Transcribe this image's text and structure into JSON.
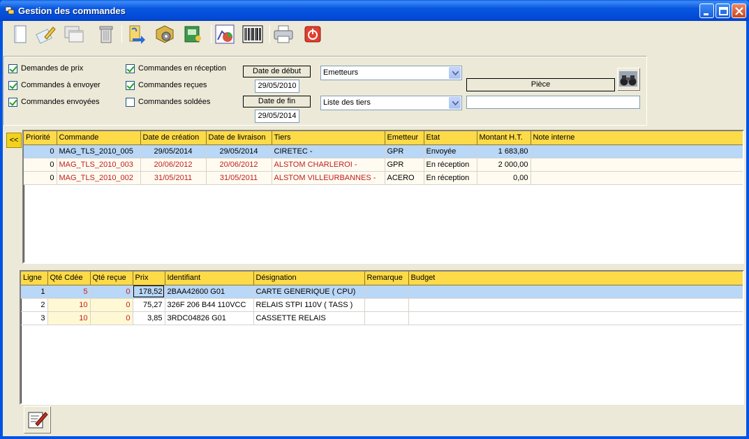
{
  "window": {
    "title": "Gestion des commandes"
  },
  "toolbar": {
    "tools": [
      {
        "name": "new-document"
      },
      {
        "name": "edit"
      },
      {
        "name": "duplicate"
      },
      {
        "name": "delete"
      },
      {
        "name": "transfer"
      },
      {
        "name": "settings"
      },
      {
        "name": "catalog"
      },
      {
        "name": "chart"
      },
      {
        "name": "barcode"
      },
      {
        "name": "print"
      },
      {
        "name": "quit"
      }
    ]
  },
  "filters": {
    "checkboxes": [
      {
        "label": "Demandes de prix",
        "checked": true
      },
      {
        "label": "Commandes à envoyer",
        "checked": true
      },
      {
        "label": "Commandes envoyées",
        "checked": true
      },
      {
        "label": "Commandes en réception",
        "checked": true
      },
      {
        "label": "Commandes reçues",
        "checked": true
      },
      {
        "label": "Commandes soldées",
        "checked": false
      }
    ],
    "date_start_label": "Date de début",
    "date_start_value": "29/05/2010",
    "date_end_label": "Date de fin",
    "date_end_value": "29/05/2014",
    "emetteurs_value": "Emetteurs",
    "tiers_value": "Liste des tiers",
    "piece_label": "Pièce",
    "piece_value": ""
  },
  "orders": {
    "columns": [
      "Priorité",
      "Commande",
      "Date de création",
      "Date de livraison",
      "Tiers",
      "Emetteur",
      "Etat",
      "Montant H.T.",
      "Note interne"
    ],
    "rows": [
      {
        "priorite": "0",
        "commande": "MAG_TLS_2010_005",
        "creation": "29/05/2014",
        "livraison": "29/05/2014",
        "tiers": "CIRETEC -",
        "emetteur": "GPR",
        "etat": "Envoyée",
        "montant": "1 683,80",
        "note": ""
      },
      {
        "priorite": "0",
        "commande": "MAG_TLS_2010_003",
        "creation": "20/06/2012",
        "livraison": "20/06/2012",
        "tiers": "ALSTOM CHARLEROI -",
        "emetteur": "GPR",
        "etat": "En réception",
        "montant": "2 000,00",
        "note": ""
      },
      {
        "priorite": "0",
        "commande": "MAG_TLS_2010_002",
        "creation": "31/05/2011",
        "livraison": "31/05/2011",
        "tiers": "ALSTOM VILLEURBANNES -",
        "emetteur": "ACERO",
        "etat": "En réception",
        "montant": "0,00",
        "note": ""
      }
    ]
  },
  "lines": {
    "columns": [
      "Ligne",
      "Qté Cdée",
      "Qté reçue",
      "Prix",
      "Identifiant",
      "Désignation",
      "Remarque",
      "Budget"
    ],
    "rows": [
      {
        "ligne": "1",
        "qte_cdee": "5",
        "qte_recue": "0",
        "prix": "178,52",
        "identifiant": "2BAA42600 G01",
        "designation": "CARTE GENERIQUE ( CPU)",
        "remarque": "",
        "budget": ""
      },
      {
        "ligne": "2",
        "qte_cdee": "10",
        "qte_recue": "0",
        "prix": "75,27",
        "identifiant": "326F 206 B44 110VCC",
        "designation": "RELAIS STPI 110V ( TASS )",
        "remarque": "",
        "budget": ""
      },
      {
        "ligne": "3",
        "qte_cdee": "10",
        "qte_recue": "0",
        "prix": "3,85",
        "identifiant": "3RDC04826 G01",
        "designation": "CASSETTE RELAIS",
        "remarque": "",
        "budget": ""
      }
    ]
  },
  "collapse_label": "<<"
}
